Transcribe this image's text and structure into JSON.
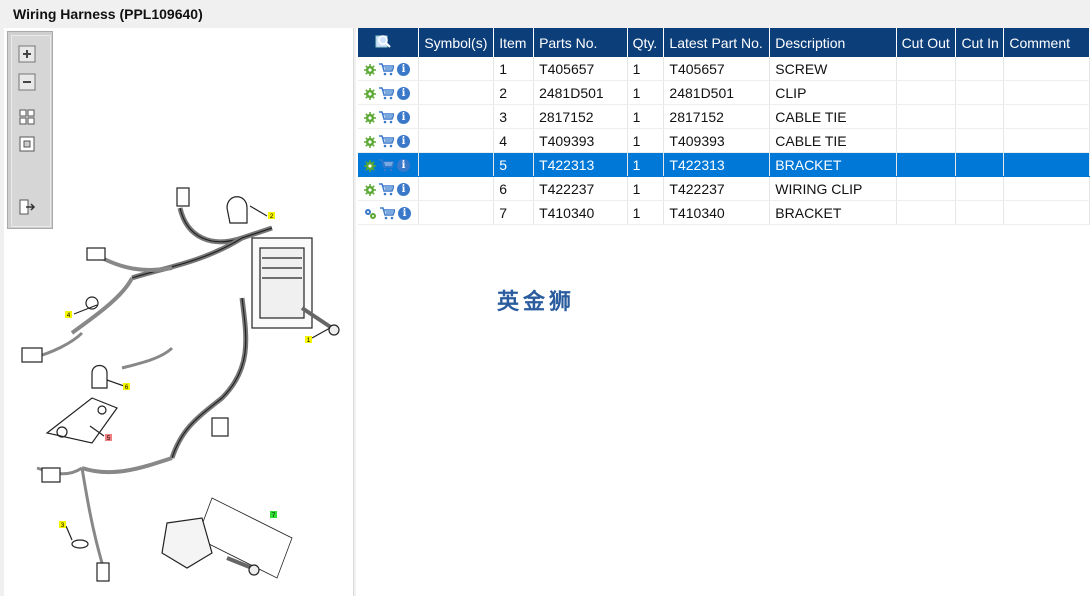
{
  "window": {
    "title": "Wiring Harness (PPL109640)"
  },
  "table": {
    "headers": {
      "symbols": "Symbol(s)",
      "item": "Item",
      "parts_no": "Parts No.",
      "qty": "Qty.",
      "latest_part_no": "Latest Part No.",
      "description": "Description",
      "cut_out": "Cut Out",
      "cut_in": "Cut In",
      "comment": "Comment"
    },
    "rows": [
      {
        "item": "1",
        "parts_no": "T405657",
        "qty": "1",
        "latest_part_no": "T405657",
        "description": "SCREW"
      },
      {
        "item": "2",
        "parts_no": "2481D501",
        "qty": "1",
        "latest_part_no": "2481D501",
        "description": "CLIP"
      },
      {
        "item": "3",
        "parts_no": "2817152",
        "qty": "1",
        "latest_part_no": "2817152",
        "description": "CABLE TIE"
      },
      {
        "item": "4",
        "parts_no": "T409393",
        "qty": "1",
        "latest_part_no": "T409393",
        "description": "CABLE TIE"
      },
      {
        "item": "5",
        "parts_no": "T422313",
        "qty": "1",
        "latest_part_no": "T422313",
        "description": "BRACKET"
      },
      {
        "item": "6",
        "parts_no": "T422237",
        "qty": "1",
        "latest_part_no": "T422237",
        "description": "WIRING CLIP"
      },
      {
        "item": "7",
        "parts_no": "T410340",
        "qty": "1",
        "latest_part_no": "T410340",
        "description": "BRACKET"
      }
    ],
    "selected_item": "5"
  },
  "watermark": "英金狮",
  "diagram": {
    "callouts": [
      "1",
      "2",
      "3",
      "4",
      "5",
      "6",
      "7"
    ]
  },
  "colors": {
    "header_bg": "#0c3e79",
    "selected_bg": "#0078d7",
    "callout_yellow": "#f5f500",
    "callout_red": "#f08080",
    "callout_green": "#33dd33"
  }
}
